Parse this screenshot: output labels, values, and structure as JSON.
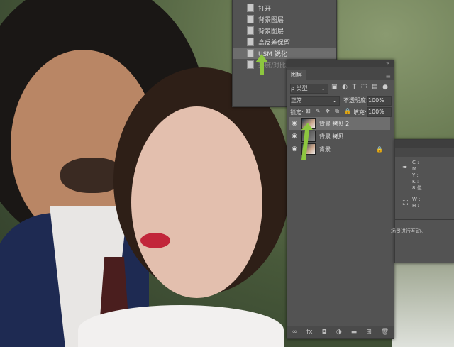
{
  "history": {
    "items": [
      {
        "label": "打开",
        "state": "normal"
      },
      {
        "label": "背景图层",
        "state": "normal"
      },
      {
        "label": "背景图层",
        "state": "normal"
      },
      {
        "label": "高反差保留",
        "state": "normal"
      },
      {
        "label": "USM 锐化",
        "state": "selected"
      },
      {
        "label": "亮度/对比度",
        "state": "disabled"
      }
    ]
  },
  "layers_panel": {
    "tab_label": "图层",
    "filter_label": "ρ 类型",
    "blend_mode": "正常",
    "opacity_label": "不透明度:",
    "opacity_value": "100%",
    "lock_label": "锁定:",
    "fill_label": "填充:",
    "fill_value": "100%",
    "layers": [
      {
        "name": "背景 拷贝 2",
        "selected": true,
        "thumb": "photo",
        "locked": false
      },
      {
        "name": "背景 拷贝",
        "selected": false,
        "thumb": "gray",
        "locked": false
      },
      {
        "name": "背景",
        "selected": false,
        "thumb": "photo",
        "locked": true
      }
    ],
    "bottom_icons": [
      "link-icon",
      "fx-icon",
      "mask-icon",
      "adjustment-icon",
      "group-icon",
      "new-layer-icon",
      "trash-icon"
    ]
  },
  "info_panel": {
    "cmyk": [
      "C :",
      "M :",
      "Y :",
      "K :"
    ],
    "bit_depth": "8 位",
    "size": [
      "W :",
      "H :"
    ],
    "status_text": "场景进行互动。"
  },
  "colors": {
    "panel_bg": "#535353",
    "selected_row": "#6e6e6e",
    "arrow": "#8dc63f"
  }
}
